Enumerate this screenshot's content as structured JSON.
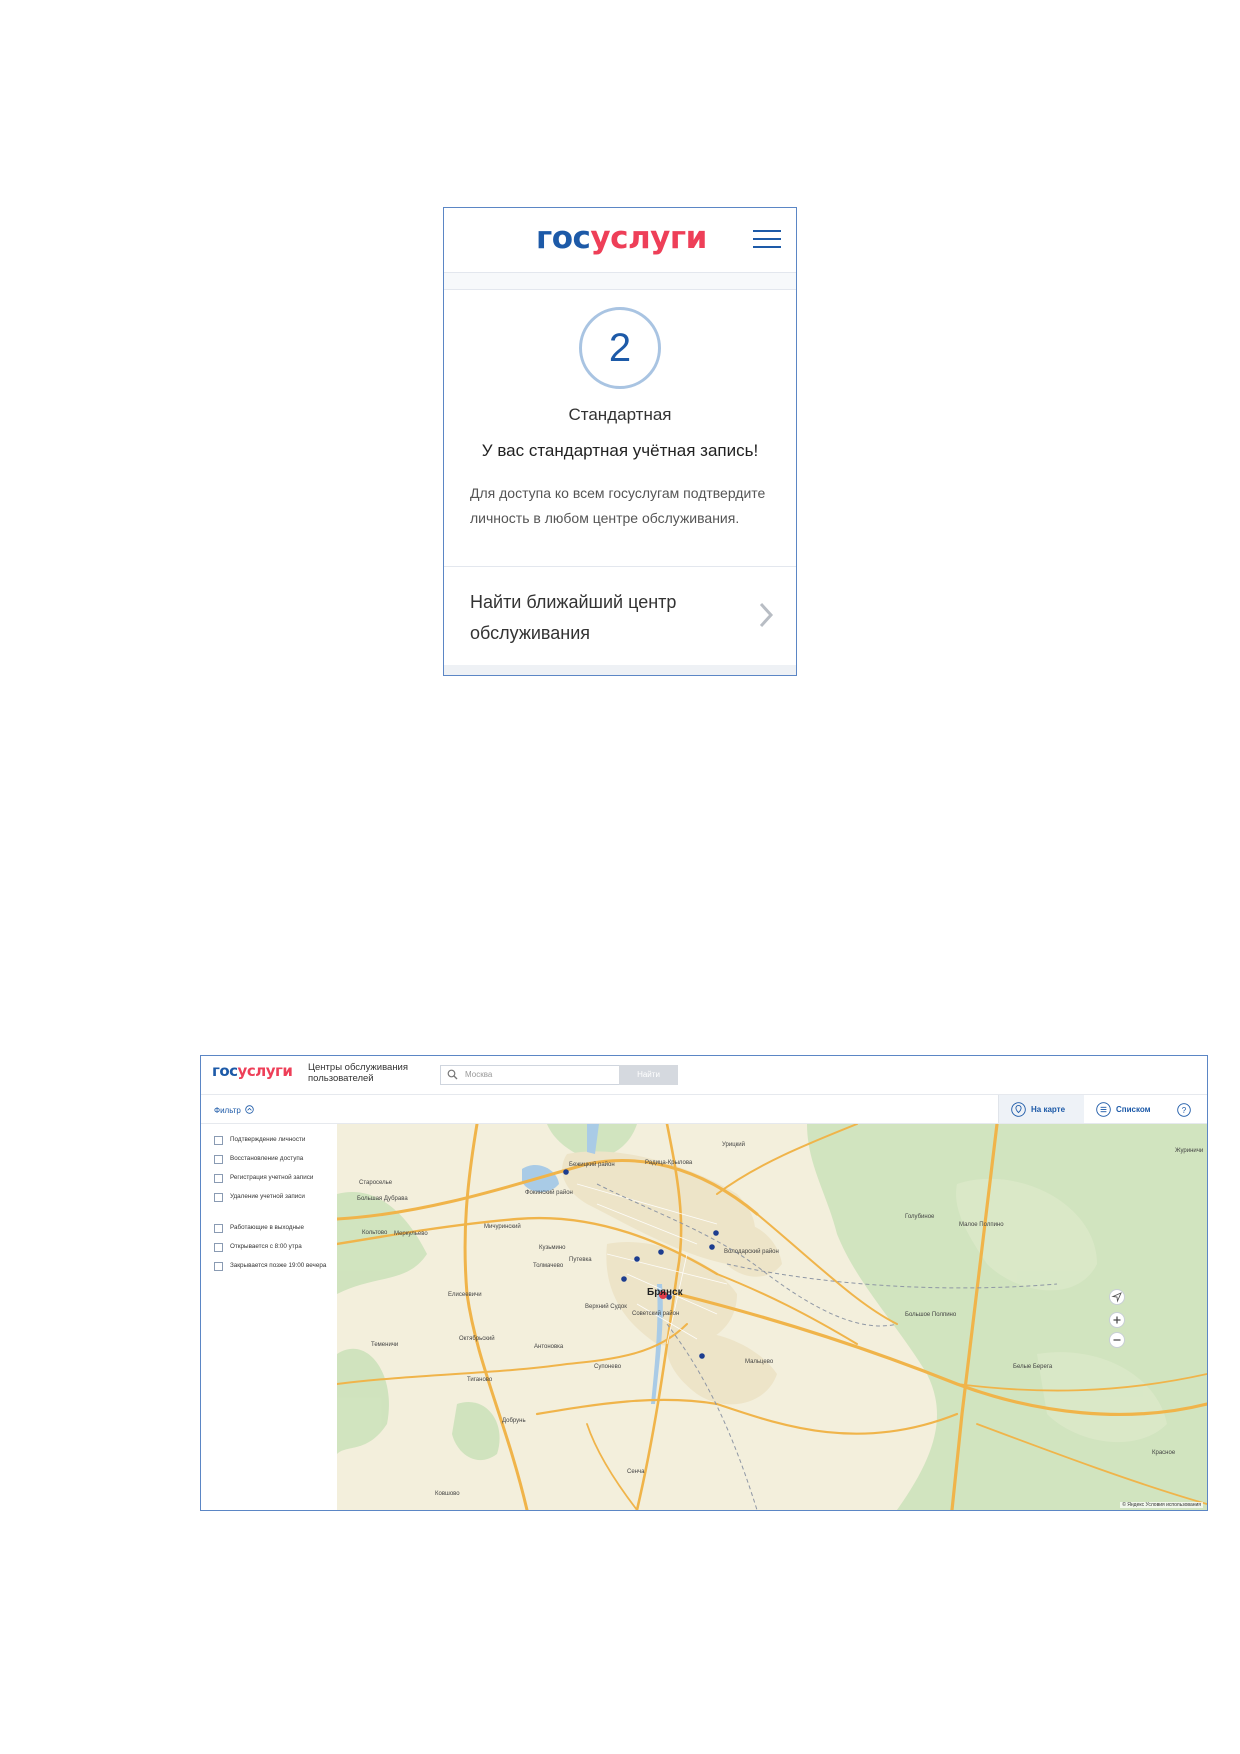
{
  "mobile": {
    "logo": {
      "part1": "гос",
      "part2": "услуги"
    },
    "level_number": "2",
    "level_name": "Стандартная",
    "message": "У вас стандартная учётная запись!",
    "description": "Для доступа ко всем госуслугам подтвердите личность в любом центре обслуживания.",
    "link_text": "Найти ближайший центр обслуживания",
    "icons": {
      "menu": "hamburger-icon",
      "chevron": "chevron-right-icon"
    }
  },
  "desktop": {
    "logo": {
      "part1": "гос",
      "part2": "услуги"
    },
    "title": "Центры обслуживания пользователей",
    "search": {
      "placeholder": "Москва",
      "button": "Найти"
    },
    "filter_label": "Фильтр",
    "tabs": {
      "map": "На карте",
      "list": "Списком"
    },
    "services": [
      "Подтверждение личности",
      "Восстановление доступа",
      "Регистрация учетной записи",
      "Удаление учетной записи"
    ],
    "options": [
      "Работающие в выходные",
      "Открывается с 8:00 утра",
      "Закрывается позже 19:00 вечера"
    ],
    "map": {
      "city": "Брянск",
      "labels": [
        "Староселье",
        "Большая Дубрава",
        "Мичуринский",
        "Кольтово",
        "Меркульево",
        "Радица-Крылова",
        "Кузьмино",
        "Путевка",
        "Толмачево",
        "Елисеевичи",
        "Октябрьский",
        "Антоновка",
        "Супонево",
        "Теменичи",
        "Тиганово",
        "Добрунь",
        "Бежицкий район",
        "Малое Полпино",
        "Белые Берега",
        "Журиничи",
        "Верхний Судок",
        "Советский район",
        "Фокинский район",
        "Володарский район",
        "Мальцево",
        "Урицкий",
        "Большое Полпино",
        "Красное",
        "Сенча",
        "Ковшово",
        "Голубиное"
      ],
      "copyright": "© Яндекс  Условия использования"
    }
  },
  "colors": {
    "brand_blue": "#1d5aa8",
    "brand_red": "#ee3f58",
    "frame": "#5b86c5"
  }
}
